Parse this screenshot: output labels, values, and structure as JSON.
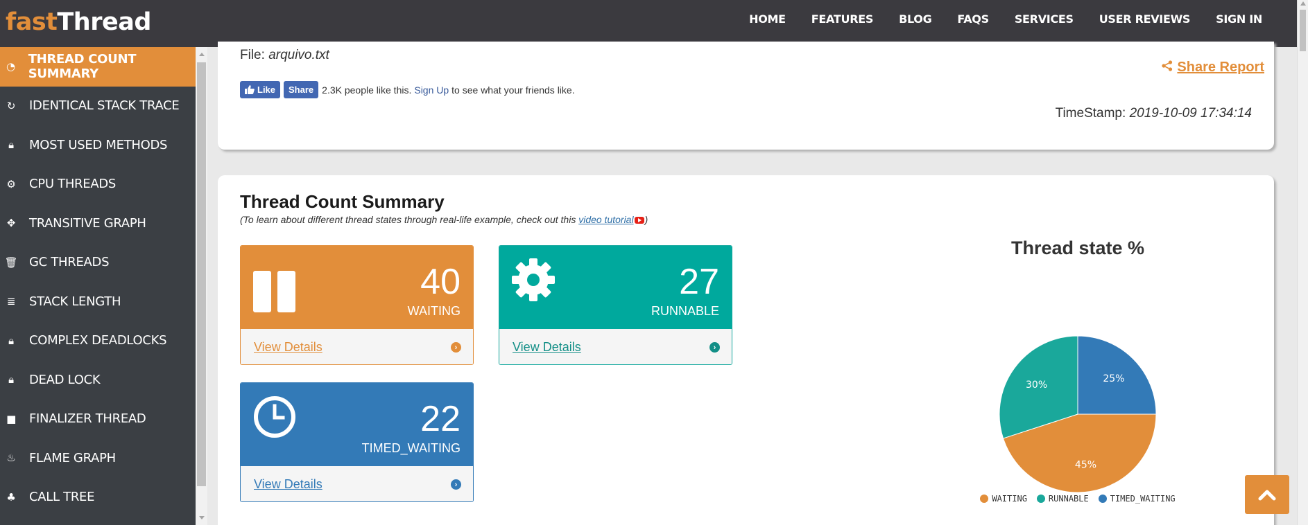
{
  "brand": {
    "part1": "fast",
    "part2": "Thread"
  },
  "nav": [
    "HOME",
    "FEATURES",
    "BLOG",
    "FAQS",
    "SERVICES",
    "USER REVIEWS",
    "SIGN IN"
  ],
  "sidebar": {
    "items": [
      {
        "label": "THREAD COUNT SUMMARY",
        "icon": "dashboard-icon",
        "glyph": "◔",
        "active": true
      },
      {
        "label": "IDENTICAL STACK TRACE",
        "icon": "refresh-icon",
        "glyph": "↻"
      },
      {
        "label": "MOST USED METHODS",
        "icon": "lock-icon",
        "glyph": "🔒︎"
      },
      {
        "label": "CPU THREADS",
        "icon": "cogs-icon",
        "glyph": "⚙"
      },
      {
        "label": "TRANSITIVE GRAPH",
        "icon": "crosshair-icon",
        "glyph": "✥"
      },
      {
        "label": "GC THREADS",
        "icon": "trash-icon",
        "glyph": "🗑︎"
      },
      {
        "label": "STACK LENGTH",
        "icon": "stack-icon",
        "glyph": "≣"
      },
      {
        "label": "COMPLEX DEADLOCKS",
        "icon": "lock-icon",
        "glyph": "🔒︎"
      },
      {
        "label": "DEAD LOCK",
        "icon": "lock-icon",
        "glyph": "🔒︎"
      },
      {
        "label": "FINALIZER THREAD",
        "icon": "square-icon",
        "glyph": "■"
      },
      {
        "label": "FLAME GRAPH",
        "icon": "fire-extinguisher-icon",
        "glyph": "♨"
      },
      {
        "label": "CALL TREE",
        "icon": "tree-icon",
        "glyph": "♣"
      }
    ]
  },
  "report": {
    "file_label": "File:",
    "file_name": "arquivo.txt",
    "fb": {
      "like": "Like",
      "share": "Share",
      "count_text": "2.3K people like this.",
      "signup": "Sign Up",
      "tail": "to see what your friends like."
    },
    "share_report": "Share Report",
    "timestamp_label": "TimeStamp:",
    "timestamp_value": "2019-10-09 17:34:14"
  },
  "summary": {
    "title": "Thread Count Summary",
    "sub_prefix": "(To learn about different thread states through real-life example, check out this",
    "sub_link": "video tutorial",
    "sub_suffix": ")",
    "stats": [
      {
        "value": "40",
        "label": "WAITING",
        "link": "View Details"
      },
      {
        "value": "27",
        "label": "RUNNABLE",
        "link": "View Details"
      },
      {
        "value": "22",
        "label": "TIMED_WAITING",
        "link": "View Details"
      }
    ]
  },
  "chart_data": {
    "type": "pie",
    "title": "Thread state %",
    "categories": [
      "WAITING",
      "RUNNABLE",
      "TIMED_WAITING"
    ],
    "values": [
      45,
      30,
      25
    ],
    "labels": [
      "45%",
      "30%",
      "25%"
    ],
    "colors": [
      "#e28e3a",
      "#1aa89b",
      "#337ab7"
    ],
    "legend_position": "bottom"
  }
}
